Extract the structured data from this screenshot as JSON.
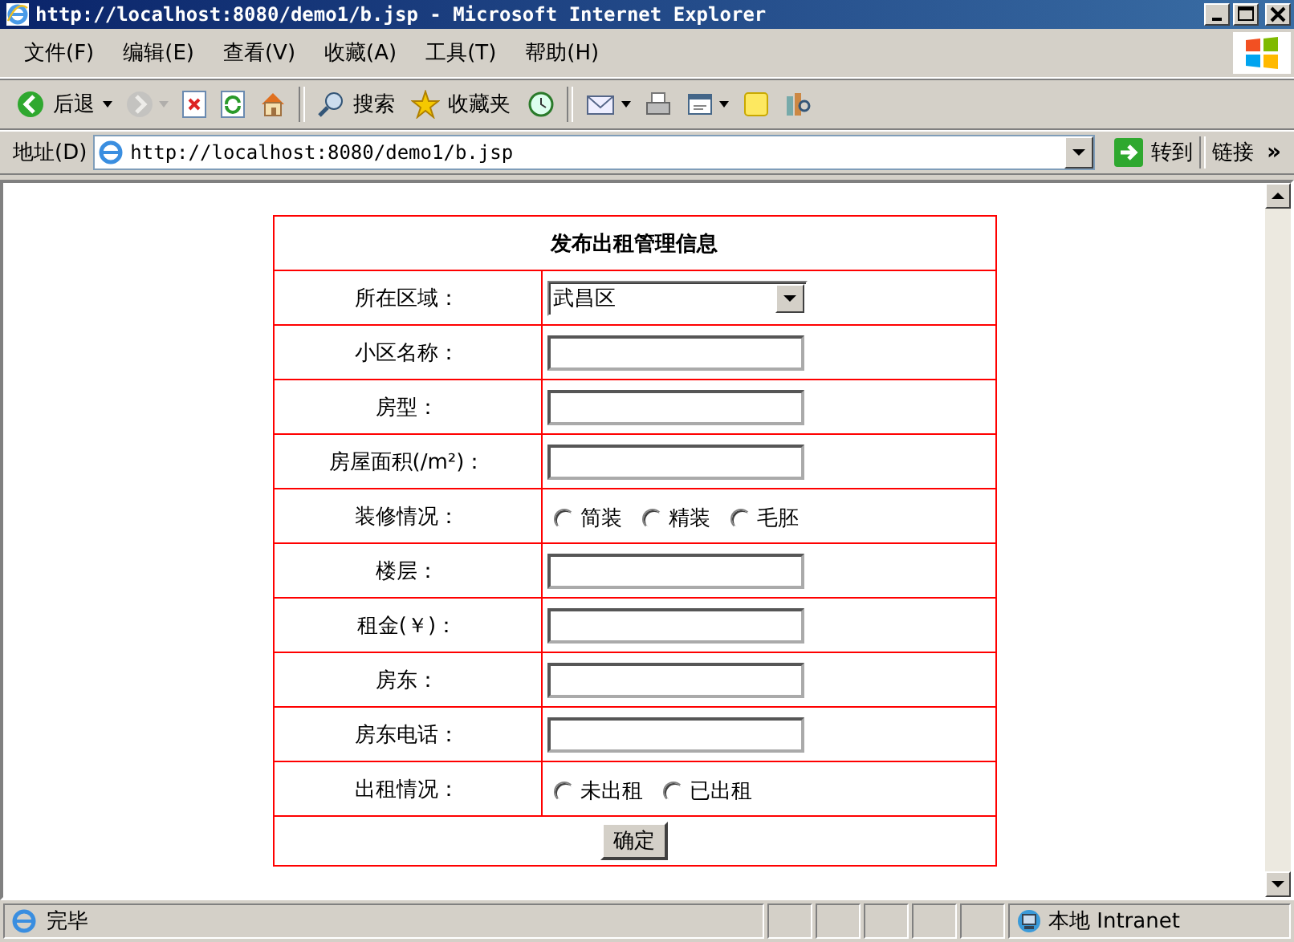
{
  "window": {
    "title": "http://localhost:8080/demo1/b.jsp - Microsoft Internet Explorer"
  },
  "menu": [
    "文件(F)",
    "编辑(E)",
    "查看(V)",
    "收藏(A)",
    "工具(T)",
    "帮助(H)"
  ],
  "toolbar": [
    {
      "kind": "back",
      "label": "后退",
      "dropdown": true,
      "disabled": false
    },
    {
      "kind": "forward",
      "dropdown": true,
      "disabled": true
    },
    {
      "kind": "stop",
      "dropdown": false,
      "disabled": false
    },
    {
      "kind": "refresh",
      "dropdown": false,
      "disabled": false
    },
    {
      "kind": "home",
      "dropdown": false,
      "disabled": false
    },
    {
      "kind": "separator"
    },
    {
      "kind": "search",
      "label": "搜索",
      "dropdown": false,
      "disabled": false
    },
    {
      "kind": "favorites",
      "label": "收藏夹",
      "dropdown": false,
      "disabled": false
    },
    {
      "kind": "history",
      "dropdown": false,
      "disabled": false
    },
    {
      "kind": "separator"
    },
    {
      "kind": "mail",
      "dropdown": true,
      "disabled": false
    },
    {
      "kind": "print",
      "dropdown": false,
      "disabled": false
    },
    {
      "kind": "edit",
      "dropdown": true,
      "disabled": false
    },
    {
      "kind": "note",
      "dropdown": false,
      "disabled": false
    },
    {
      "kind": "research",
      "dropdown": false,
      "disabled": false
    }
  ],
  "address": {
    "label": "地址(D)",
    "url": "http://localhost:8080/demo1/b.jsp",
    "go": "转到",
    "links": "链接",
    "more": "»"
  },
  "form": {
    "title": "发布出租管理信息",
    "rows": [
      {
        "label": "所在区域：",
        "kind": "select",
        "value": "武昌区"
      },
      {
        "label": "小区名称：",
        "kind": "text"
      },
      {
        "label": "房型：",
        "kind": "text"
      },
      {
        "label": "房屋面积(/m²)：",
        "kind": "text"
      },
      {
        "label": "装修情况：",
        "kind": "radio",
        "options": [
          {
            "label": "简装",
            "selected": false
          },
          {
            "label": "精装",
            "selected": false
          },
          {
            "label": "毛胚",
            "selected": false
          }
        ]
      },
      {
        "label": "楼层：",
        "kind": "text"
      },
      {
        "label": "租金(￥)：",
        "kind": "text"
      },
      {
        "label": "房东：",
        "kind": "text"
      },
      {
        "label": "房东电话：",
        "kind": "text"
      },
      {
        "label": "出租情况：",
        "kind": "radio",
        "options": [
          {
            "label": "未出租",
            "selected": false
          },
          {
            "label": "已出租",
            "selected": false
          }
        ]
      }
    ],
    "submit": "确定"
  },
  "status_bar": {
    "text": "完毕",
    "zone": "本地 Intranet"
  }
}
